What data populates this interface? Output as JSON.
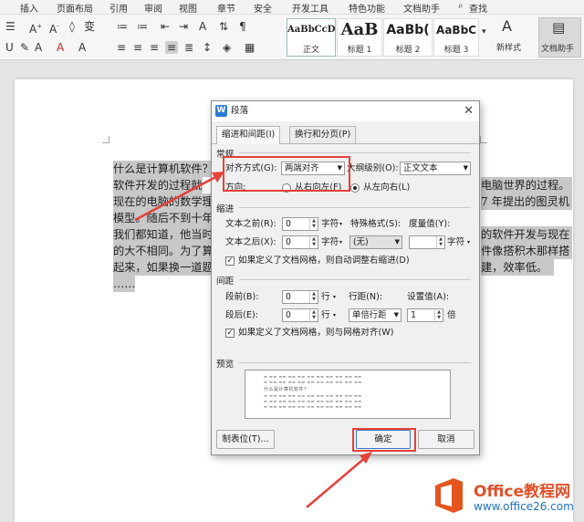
{
  "ribbon": {
    "tabs": [
      "插入",
      "页面布局",
      "引用",
      "审阅",
      "视图",
      "章节",
      "安全",
      "开发工具",
      "特色功能",
      "文档助手",
      "查找"
    ],
    "styles": [
      {
        "preview": "AaBbCcDd",
        "name": "正文"
      },
      {
        "preview": "AaB",
        "name": "标题 1"
      },
      {
        "preview": "AaBb(",
        "name": "标题 2"
      },
      {
        "preview": "AaBbC",
        "name": "标题 3"
      }
    ],
    "new_style_label": "新样式",
    "doc_helper_label": "文档助手"
  },
  "document": {
    "lines": [
      "什么是计算机软件？",
      "软件开发的过程就",
      "现在的电脑的数学理",
      "模型。随后不到十年",
      "我们都知道，他当时",
      "的大不相同。为了算",
      "起来，如果换一道题",
      "……"
    ],
    "right_fragments": [
      "电脑世界的过程。",
      "7 年提出的图灵机",
      "的软件开发与现在",
      "件像搭积木那样搭",
      "建，效率低。"
    ]
  },
  "dialog": {
    "title": "段落",
    "tabs": [
      "缩进和间距(I)",
      "换行和分页(P)"
    ],
    "general": {
      "heading": "常规",
      "align_label": "对齐方式(G):",
      "align_value": "两端对齐",
      "outline_label": "大纲级别(O):",
      "outline_value": "正文文本",
      "direction_label": "方向:",
      "rtl_label": "从右向左(F)",
      "ltr_label": "从左向右(L)"
    },
    "indent": {
      "heading": "缩进",
      "before_label": "文本之前(R):",
      "before_value": "0",
      "after_label": "文本之后(X):",
      "after_value": "0",
      "unit": "字符",
      "special_label": "特殊格式(S):",
      "special_value": "(无)",
      "measure_label": "度量值(Y):",
      "auto_adjust": "如果定义了文档网格，则自动调整右缩进(D)"
    },
    "spacing": {
      "heading": "间距",
      "before_label": "段前(B):",
      "before_value": "0",
      "after_label": "段后(E):",
      "after_value": "0",
      "unit": "行",
      "line_label": "行距(N):",
      "line_value": "单倍行距",
      "setting_label": "设置值(A):",
      "setting_value": "1",
      "setting_unit": "倍",
      "grid_align": "如果定义了文档网格，则与网格对齐(W)"
    },
    "preview_heading": "预览",
    "preview_text": "什么是计算机软件？",
    "buttons": {
      "tabs": "制表位(T)...",
      "ok": "确定",
      "cancel": "取消"
    }
  },
  "brand": {
    "name": "Office教程网",
    "url": "www.office26.com"
  }
}
